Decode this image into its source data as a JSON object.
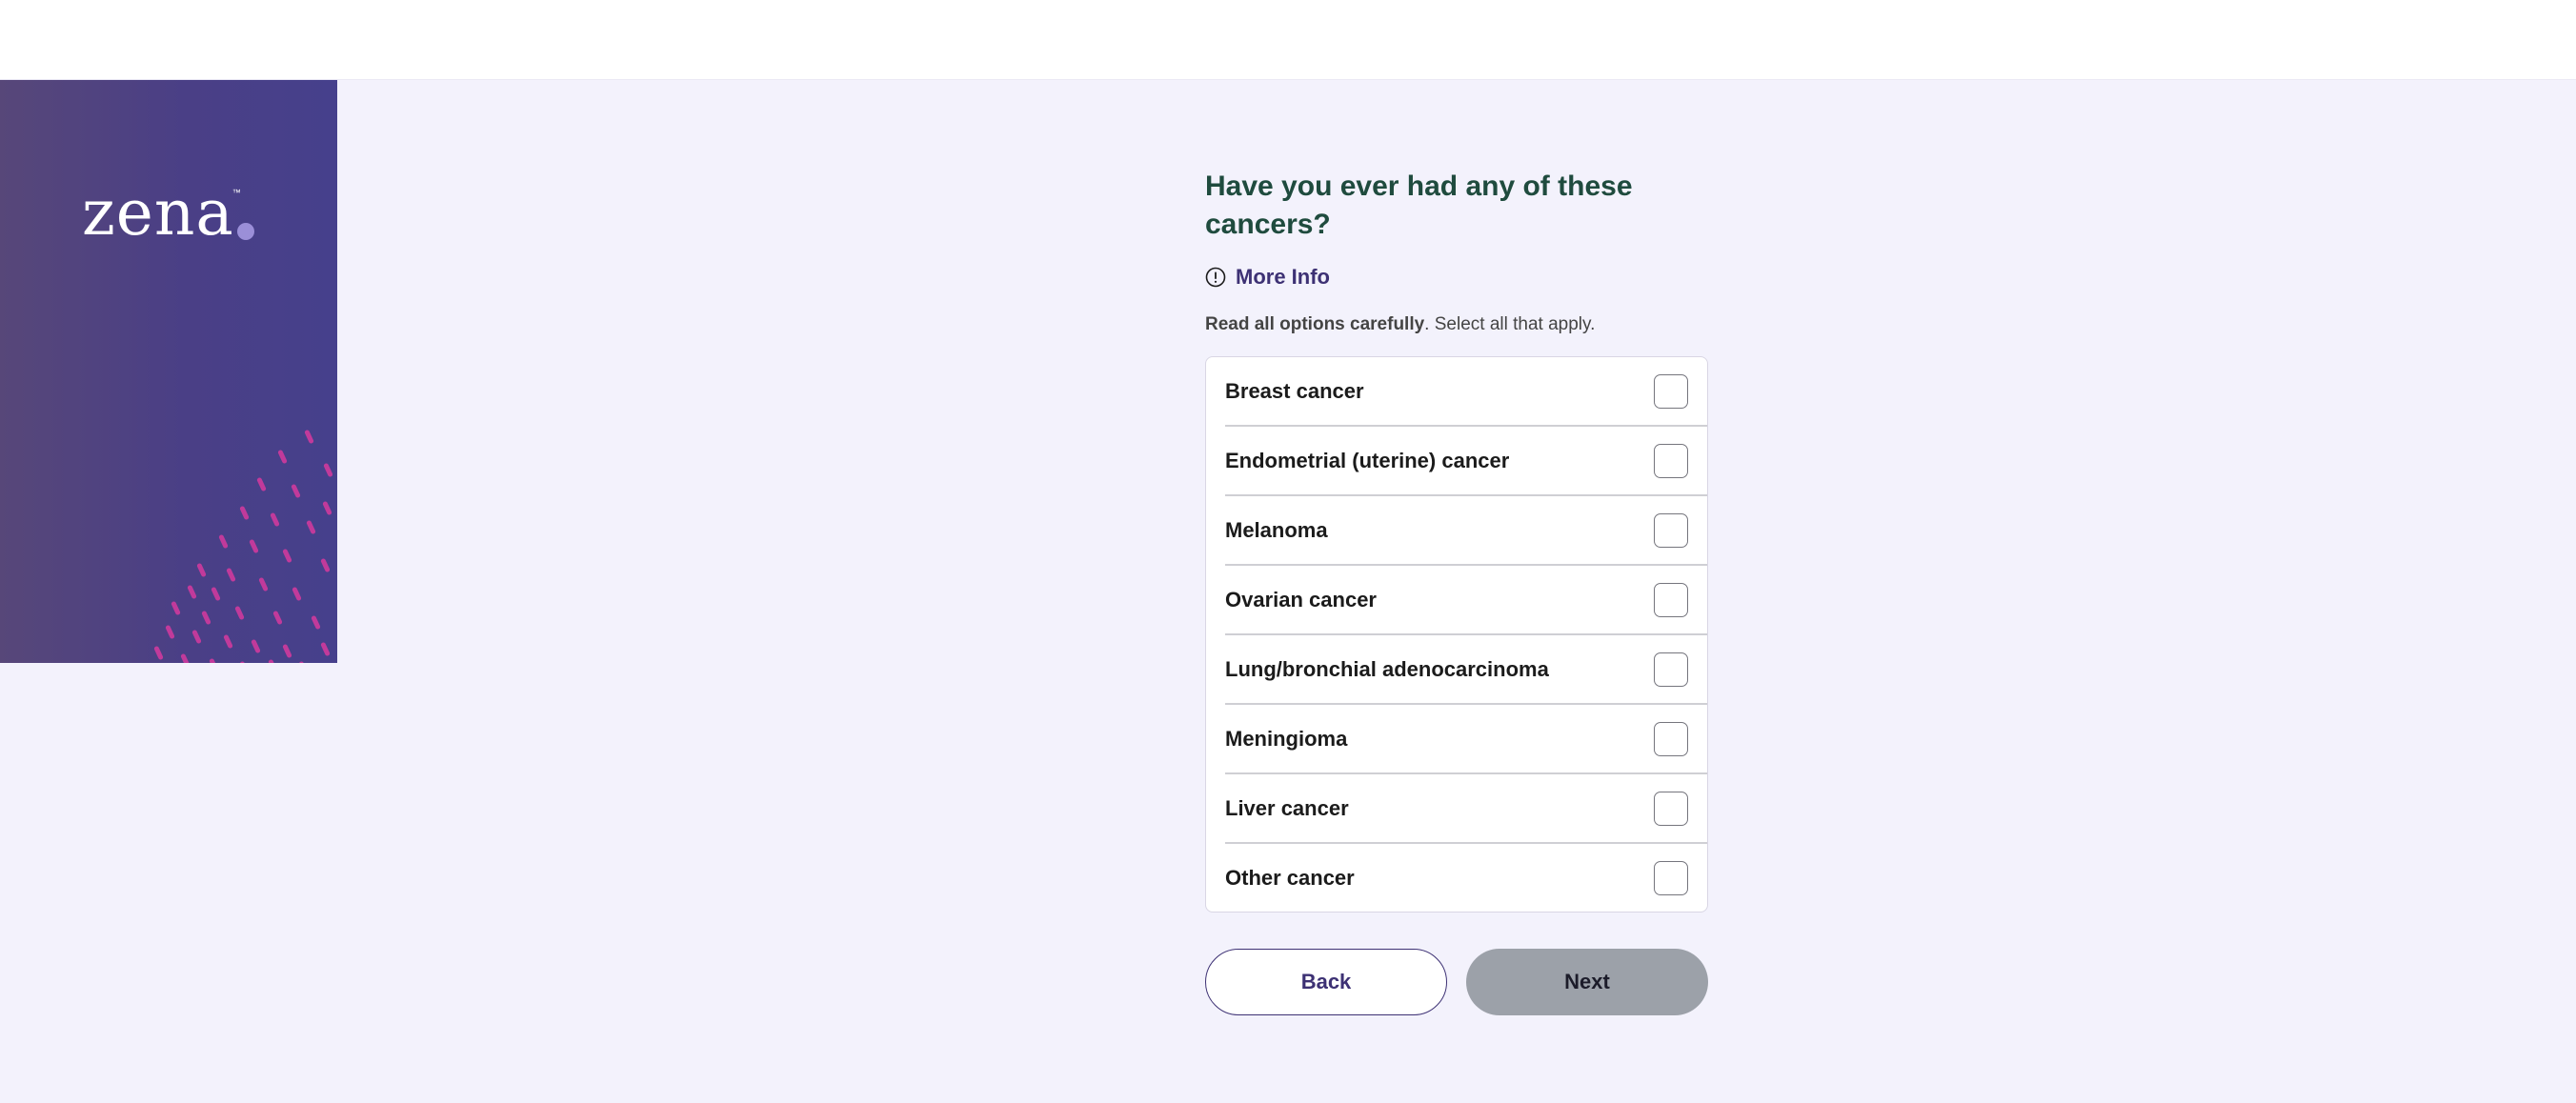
{
  "brand": {
    "logo_text": "zena",
    "logo_tm": "™"
  },
  "question": {
    "title": "Have you ever had any of these cancers?",
    "more_info_label": "More Info",
    "instructions_bold": "Read all options carefully",
    "instructions_rest": ". Select all that apply."
  },
  "options": [
    {
      "label": "Breast cancer",
      "checked": false
    },
    {
      "label": "Endometrial (uterine) cancer",
      "checked": false
    },
    {
      "label": "Melanoma",
      "checked": false
    },
    {
      "label": "Ovarian cancer",
      "checked": false
    },
    {
      "label": "Lung/bronchial adenocarcinoma",
      "checked": false
    },
    {
      "label": "Meningioma",
      "checked": false
    },
    {
      "label": "Liver cancer",
      "checked": false
    },
    {
      "label": "Other cancer",
      "checked": false
    }
  ],
  "buttons": {
    "back_label": "Back",
    "next_label": "Next"
  },
  "colors": {
    "heading": "#1f4b3e",
    "accent": "#3d3174",
    "brand_dot": "#9b8fd8",
    "pattern_dash": "#c13a9b",
    "next_disabled": "#9ca1a9",
    "page_background": "#f3f2fc"
  },
  "icons": {
    "more_info": "info-circle-icon"
  }
}
